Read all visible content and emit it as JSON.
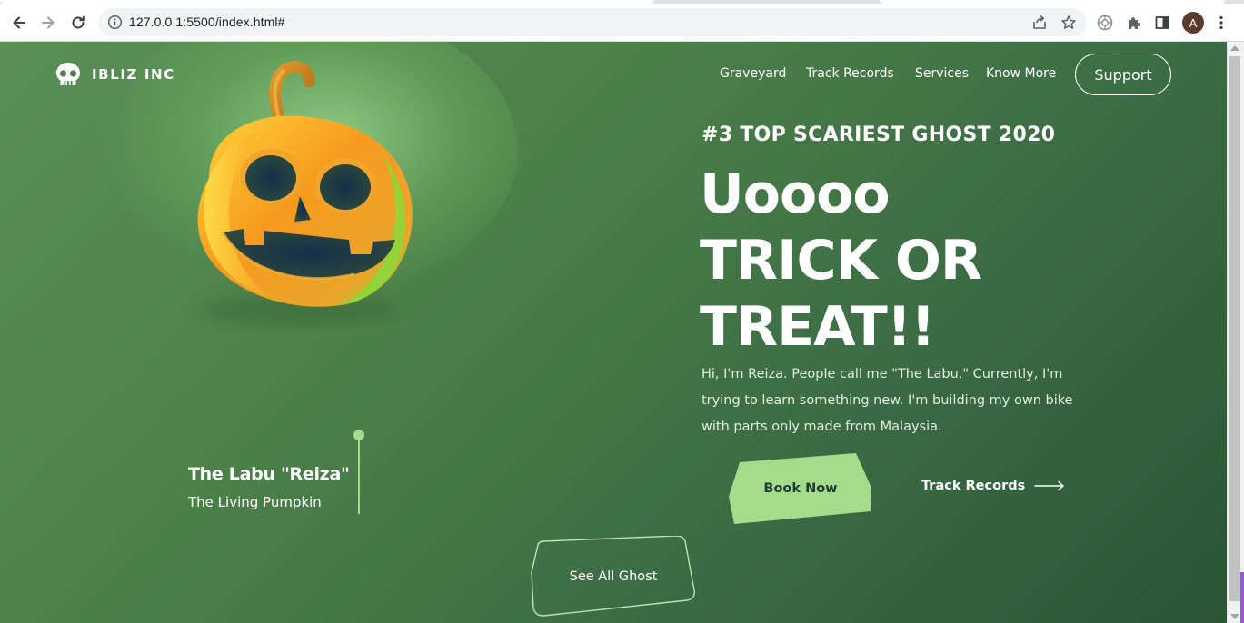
{
  "browser": {
    "url": "127.0.0.1:5500/index.html#",
    "profile_initial": "A",
    "icons": {
      "back": "arrow-left-icon",
      "forward": "arrow-right-icon",
      "reload": "reload-icon",
      "site_info": "info-icon",
      "share": "share-icon",
      "bookmark": "star-icon",
      "extension_web": "web-extension-icon",
      "extensions": "puzzle-icon",
      "side_panel": "side-panel-icon",
      "menu": "kebab-menu-icon"
    }
  },
  "site": {
    "brand": "IBLIZ INC",
    "nav": [
      "Graveyard",
      "Track Records",
      "Services",
      "Know More"
    ],
    "support_label": "Support",
    "hero": {
      "kicker": "#3 TOP SCARIEST GHOST 2020",
      "headline": [
        "Uoooo",
        "TRICK OR",
        "TREAT!!"
      ],
      "intro": "Hi, I'm Reiza. People call me \"The Labu.\" Currently, I'm trying to learn something new. I'm building my own bike with parts only made from Malaysia.",
      "book_label": "Book Now",
      "track_label": "Track Records"
    },
    "caption": {
      "title": "The Labu \"Reiza\"",
      "subtitle": "The Living Pumpkin"
    },
    "see_all_label": "See All Ghost"
  },
  "colors": {
    "page_bg_start": "#5a8f56",
    "page_bg_end": "#2b5536",
    "accent": "#a4dc8c",
    "button_text": "#1f3a33",
    "pumpkin_orange": "#f7941d",
    "pumpkin_yellow": "#ffd23a",
    "pumpkin_green": "#6fdc3a"
  }
}
